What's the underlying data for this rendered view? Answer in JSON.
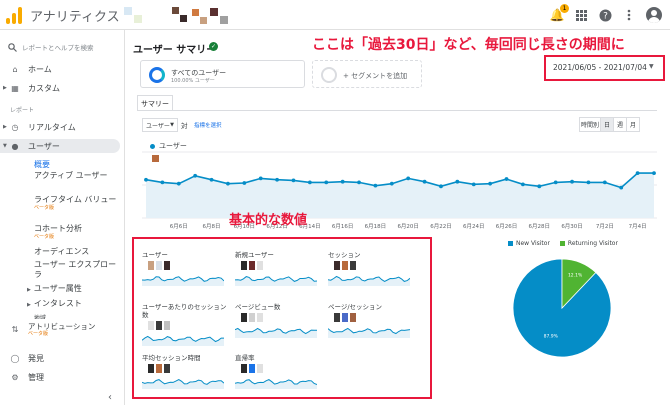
{
  "app": {
    "name": "アナリティクス"
  },
  "topbar": {
    "notification_count": "1"
  },
  "sidebar": {
    "search_placeholder": "レポートとヘルプを検索",
    "home": "ホーム",
    "custom": "カスタム",
    "reports_section": "レポート",
    "realtime": "リアルタイム",
    "audience": "ユーザー",
    "overview": "概要",
    "active_users": "アクティブ ユーザー",
    "lifetime_value": "ライフタイム バリュー",
    "beta": "ベータ版",
    "cohort": "コホート分析",
    "audiences": "オーディエンス",
    "user_explorer": "ユーザー エクスプローラ",
    "user_attributes": "ユーザー属性",
    "interests": "インタレスト",
    "geo": "地域",
    "attribution": "アトリビューション",
    "discover": "発見",
    "admin": "管理"
  },
  "main": {
    "page_title": "ユーザー サマリー",
    "annotation_top": "ここは「過去30日」など、毎回同じ長さの期間に",
    "annotation_mid": "基本的な数値",
    "date_range": "2021/06/05 - 2021/07/04",
    "segment_all": "すべてのユーザー",
    "segment_all_sub": "100.00% ユーザー",
    "segment_add": "+ セグメントを追加",
    "tab_summary": "サマリー",
    "metric_selected": "ユーザー",
    "vs": "対",
    "pick_metric": "指標を選択",
    "granularity": [
      "時間別",
      "日",
      "週",
      "月"
    ],
    "legend_series": "ユーザー"
  },
  "tiles": [
    {
      "label": "ユーザー"
    },
    {
      "label": "新規ユーザー"
    },
    {
      "label": "セッション"
    },
    {
      "label": "ユーザーあたりのセッション数"
    },
    {
      "label": "ページビュー数"
    },
    {
      "label": "ページ/セッション"
    },
    {
      "label": "平均セッション時間"
    },
    {
      "label": "直帰率"
    }
  ],
  "colors": {
    "accent": "#1a73e8",
    "annotation": "#e8183c",
    "series": "#058dc7",
    "returning": "#50b432"
  },
  "chart_data": [
    {
      "type": "area",
      "categories": [
        "6月6日",
        "6月8日",
        "6月10日",
        "6月12日",
        "6月14日",
        "6月16日",
        "6月18日",
        "6月20日",
        "6月22日",
        "6月24日",
        "6月26日",
        "6月28日",
        "6月30日",
        "7月2日",
        "7月4日"
      ],
      "series": [
        {
          "name": "ユーザー",
          "values": [
            58,
            54,
            52,
            64,
            58,
            52,
            53,
            60,
            58,
            57,
            54,
            54,
            55,
            54,
            49,
            52,
            60,
            55,
            48,
            55,
            51,
            52,
            59,
            51,
            48,
            54,
            55,
            54,
            54,
            46,
            68,
            68
          ]
        }
      ],
      "ylim": [
        0,
        100
      ],
      "grid": true
    },
    {
      "type": "pie",
      "categories": [
        "New Visitor",
        "Returning Visitor"
      ],
      "values": [
        87.9,
        12.1
      ],
      "data_labels": [
        "87.9%",
        "12.1%"
      ],
      "legend": "top"
    }
  ]
}
